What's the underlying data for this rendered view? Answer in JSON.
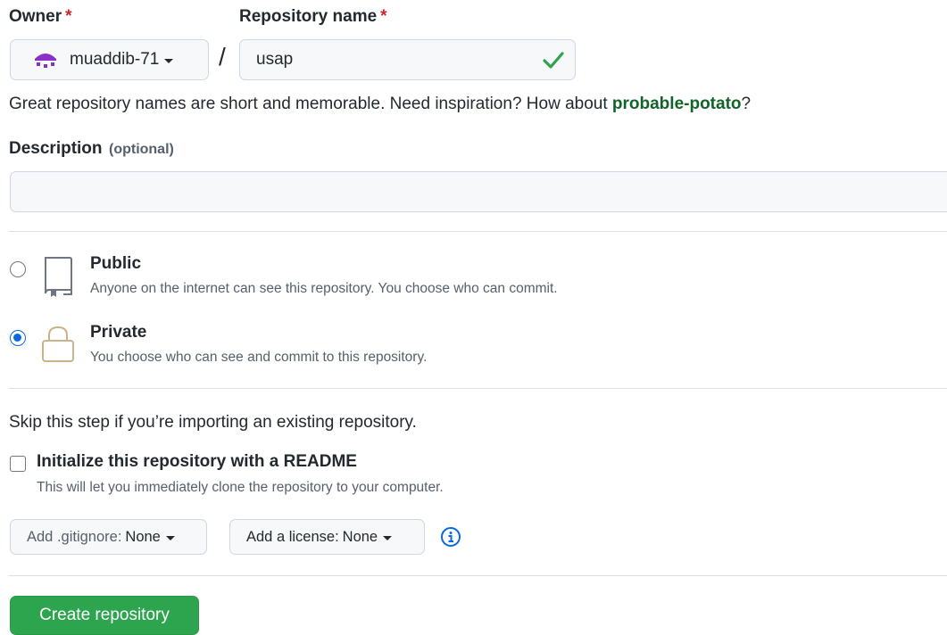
{
  "owner": {
    "label": "Owner",
    "required_mark": "*",
    "selected": "muaddib-71"
  },
  "repo": {
    "label": "Repository name",
    "required_mark": "*",
    "separator": "/",
    "value": "usap",
    "valid": true
  },
  "hint": {
    "prefix": "Great repository names are short and memorable. Need inspiration? How about ",
    "suggestion": "probable-potato",
    "suffix": "?"
  },
  "description": {
    "label": "Description",
    "optional": "(optional)",
    "value": "",
    "placeholder": ""
  },
  "visibility": {
    "selected": "private",
    "options": [
      {
        "id": "public",
        "title": "Public",
        "desc": "Anyone on the internet can see this repository. You choose who can commit."
      },
      {
        "id": "private",
        "title": "Private",
        "desc": "You choose who can see and commit to this repository."
      }
    ]
  },
  "init": {
    "skip_text": "Skip this step if you’re importing an existing repository.",
    "readme_label": "Initialize this repository with a README",
    "readme_desc": "This will let you immediately clone the repository to your computer.",
    "readme_checked": false
  },
  "gitignore": {
    "prefix": "Add .gitignore:",
    "value": "None"
  },
  "license": {
    "prefix": "Add a license:",
    "value": "None"
  },
  "submit": {
    "label": "Create repository"
  },
  "colors": {
    "accent_green": "#2da44e",
    "suggestion_green": "#116329",
    "radio_blue": "#0969da",
    "required_red": "#cf222e",
    "lock_tan": "#bf8700",
    "info_blue": "#0969da"
  }
}
